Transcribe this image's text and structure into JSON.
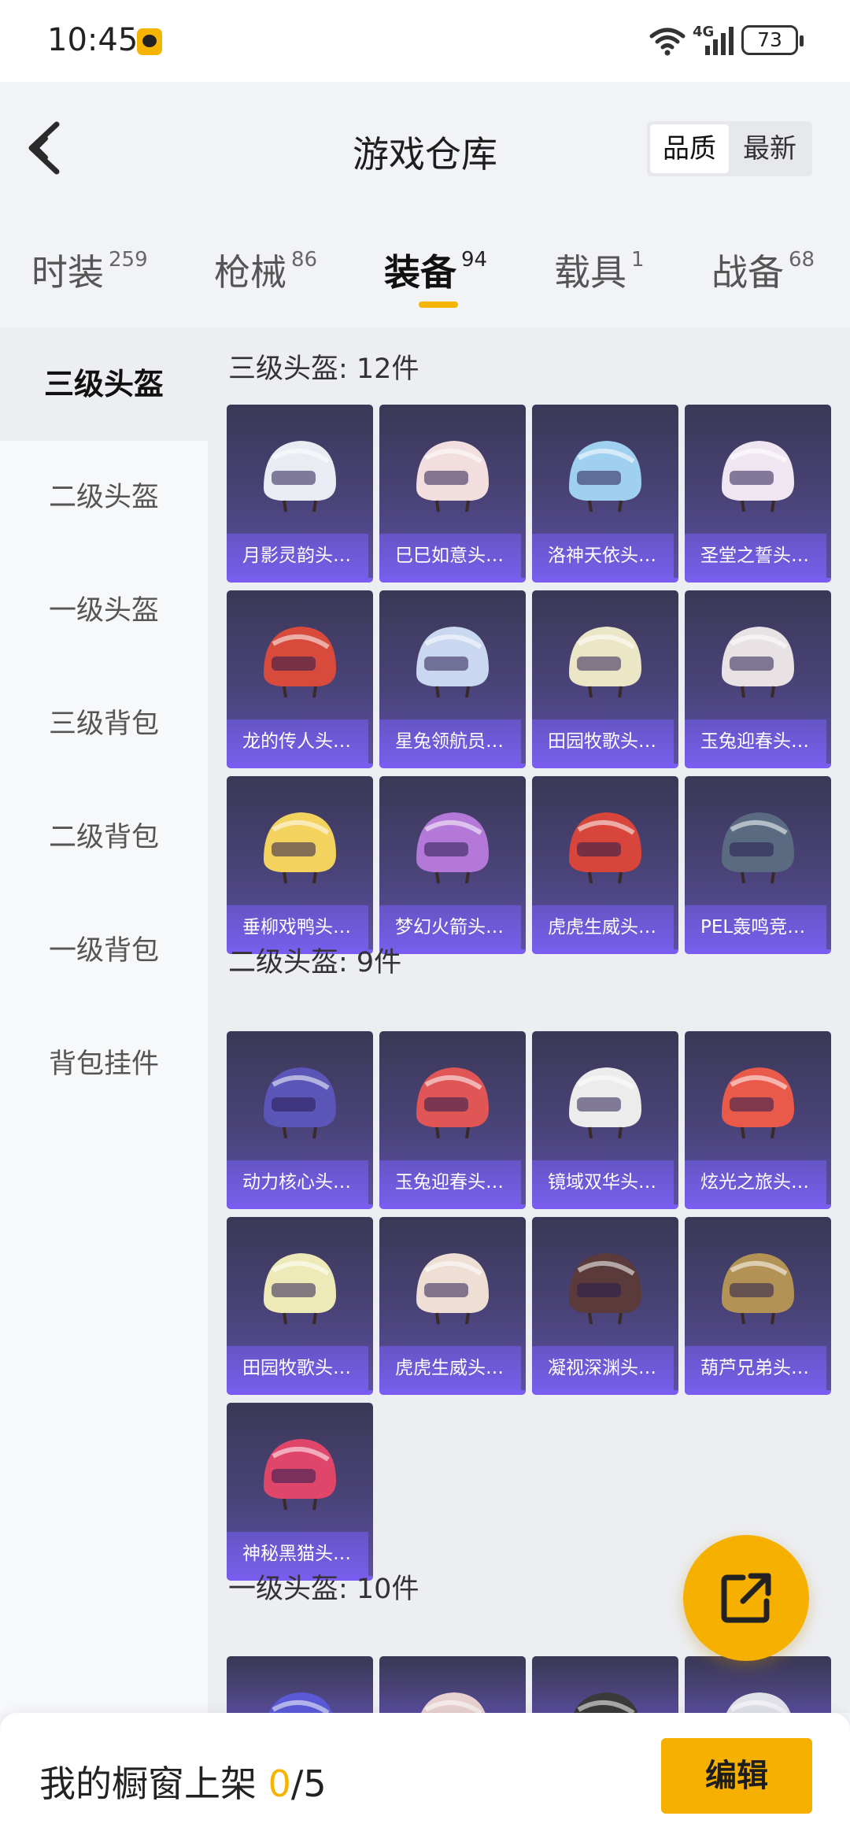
{
  "status_bar": {
    "time": "10:45",
    "network": "4G",
    "battery": "73"
  },
  "header": {
    "title": "游戏仓库",
    "sort_options": [
      "品质",
      "最新"
    ]
  },
  "tabs": [
    {
      "label": "时装",
      "count": "259"
    },
    {
      "label": "枪械",
      "count": "86"
    },
    {
      "label": "装备",
      "count": "94"
    },
    {
      "label": "载具",
      "count": "1"
    },
    {
      "label": "战备",
      "count": "68"
    }
  ],
  "active_tab": "装备",
  "sidebar": {
    "items": [
      "三级头盔",
      "二级头盔",
      "一级头盔",
      "三级背包",
      "二级背包",
      "一级背包",
      "背包挂件"
    ],
    "active": "三级头盔"
  },
  "sections": [
    {
      "title": "三级头盔: 12件",
      "items": [
        {
          "name": "月影灵韵头…",
          "icon": "helmet-icon",
          "color": "#e9ecf2"
        },
        {
          "name": "巳巳如意头…",
          "icon": "helmet-icon",
          "color": "#f2dede"
        },
        {
          "name": "洛神天依头…",
          "icon": "helmet-icon",
          "color": "#9fd0ef"
        },
        {
          "name": "圣堂之誓头…",
          "icon": "helmet-icon",
          "color": "#efe6f2"
        },
        {
          "name": "龙的传人头…",
          "icon": "helmet-icon",
          "color": "#d84a3c"
        },
        {
          "name": "星兔领航员…",
          "icon": "helmet-icon",
          "color": "#c9d7f0"
        },
        {
          "name": "田园牧歌头…",
          "icon": "helmet-icon",
          "color": "#eae6c6"
        },
        {
          "name": "玉兔迎春头…",
          "icon": "helmet-icon",
          "color": "#e8e2e4"
        },
        {
          "name": "垂柳戏鸭头…",
          "icon": "helmet-icon",
          "color": "#f3d35e"
        },
        {
          "name": "梦幻火箭头…",
          "icon": "helmet-icon",
          "color": "#b479d8"
        },
        {
          "name": "虎虎生威头…",
          "icon": "helmet-icon",
          "color": "#d8453a"
        },
        {
          "name": "PEL轰鸣竞…",
          "icon": "helmet-icon",
          "color": "#5a6a80"
        }
      ]
    },
    {
      "title": "二级头盔: 9件",
      "items": [
        {
          "name": "动力核心头…",
          "icon": "helmet-icon",
          "color": "#5b55b8"
        },
        {
          "name": "玉兔迎春头…",
          "icon": "helmet-icon",
          "color": "#e05555"
        },
        {
          "name": "镜域双华头…",
          "icon": "helmet-icon",
          "color": "#ececec"
        },
        {
          "name": "炫光之旅头…",
          "icon": "helmet-icon",
          "color": "#ea5a4a"
        },
        {
          "name": "田园牧歌头…",
          "icon": "helmet-icon",
          "color": "#eeeab8"
        },
        {
          "name": "虎虎生威头…",
          "icon": "helmet-icon",
          "color": "#eeded4"
        },
        {
          "name": "凝视深渊头…",
          "icon": "helmet-icon",
          "color": "#5a3a3a"
        },
        {
          "name": "葫芦兄弟头…",
          "icon": "helmet-icon",
          "color": "#b39256"
        },
        {
          "name": "神秘黑猫头…",
          "icon": "helmet-icon",
          "color": "#e0456a"
        }
      ]
    },
    {
      "title": "一级头盔: 10件",
      "items": [
        {
          "name": "",
          "icon": "helmet-icon",
          "color": "#5a5ad8"
        },
        {
          "name": "",
          "icon": "helmet-icon",
          "color": "#e8d0d0"
        },
        {
          "name": "",
          "icon": "helmet-icon",
          "color": "#3a3a3a"
        },
        {
          "name": "",
          "icon": "helmet-icon",
          "color": "#e0e0e8"
        }
      ]
    }
  ],
  "bottom_bar": {
    "label": "我的橱窗上架",
    "current": "0",
    "total": "/5",
    "edit_label": "编辑"
  },
  "colors": {
    "accent": "#f5b400",
    "card_border": "#7a5cf0"
  }
}
